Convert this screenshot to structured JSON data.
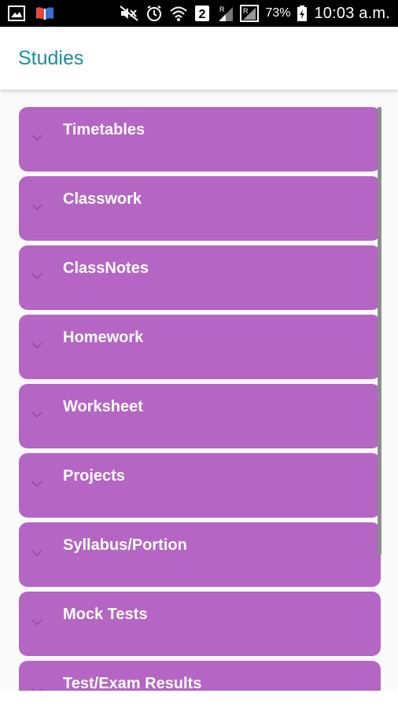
{
  "status_bar": {
    "battery": "73%",
    "time": "10:03 a.m.",
    "icons": [
      "gallery-icon",
      "book-icon",
      "mute-icon",
      "alarm-icon",
      "wifi-icon",
      "sim-2-icon",
      "signal-r-icon",
      "signal-r-box-icon",
      "battery-charging-icon"
    ]
  },
  "app_bar": {
    "title": "Studies"
  },
  "colors": {
    "accent": "#1a8f9b",
    "item_bg": "#b565c4"
  },
  "items": [
    {
      "label": "Timetables"
    },
    {
      "label": "Classwork"
    },
    {
      "label": "ClassNotes"
    },
    {
      "label": "Homework"
    },
    {
      "label": "Worksheet"
    },
    {
      "label": "Projects"
    },
    {
      "label": "Syllabus/Portion"
    },
    {
      "label": "Mock Tests"
    },
    {
      "label": "Test/Exam Results"
    }
  ]
}
